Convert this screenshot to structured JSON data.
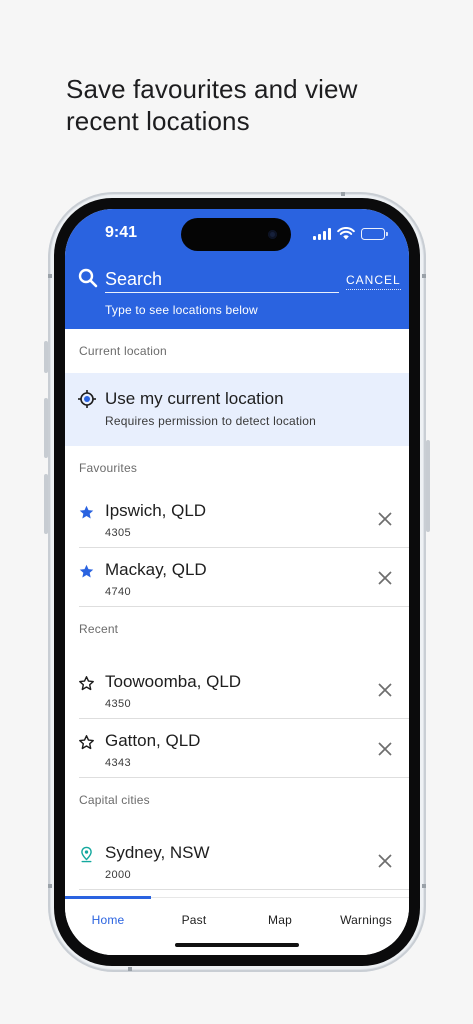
{
  "headline": {
    "line1": "Save favourites and view",
    "line2": "recent locations"
  },
  "status_bar": {
    "time": "9:41",
    "icons": [
      "signal-icon",
      "wifi-icon",
      "battery-icon"
    ]
  },
  "search": {
    "placeholder": "Search",
    "value": "",
    "cancel_label": "CANCEL",
    "hint": "Type to see locations below"
  },
  "current_location": {
    "section_label": "Current location",
    "title": "Use my current location",
    "subtitle": "Requires permission to detect location",
    "icon": "crosshair-icon"
  },
  "favourites": {
    "section_label": "Favourites",
    "items": [
      {
        "name": "Ipswich, QLD",
        "postcode": "4305",
        "icon": "star-filled-icon"
      },
      {
        "name": "Mackay, QLD",
        "postcode": "4740",
        "icon": "star-filled-icon"
      }
    ]
  },
  "recent": {
    "section_label": "Recent",
    "items": [
      {
        "name": "Toowoomba, QLD",
        "postcode": "4350",
        "icon": "star-outline-icon"
      },
      {
        "name": "Gatton, QLD",
        "postcode": "4343",
        "icon": "star-outline-icon"
      }
    ]
  },
  "capital_cities": {
    "section_label": "Capital cities",
    "items": [
      {
        "name": "Sydney, NSW",
        "postcode": "2000",
        "icon": "location-pin-icon"
      }
    ]
  },
  "tabs": [
    {
      "label": "Home",
      "active": true
    },
    {
      "label": "Past",
      "active": false
    },
    {
      "label": "Map",
      "active": false
    },
    {
      "label": "Warnings",
      "active": false
    }
  ],
  "colors": {
    "brand_blue": "#2a63e0",
    "highlight_row": "#e8effd",
    "pin_teal": "#13a89e",
    "background": "#f6f6f6"
  }
}
